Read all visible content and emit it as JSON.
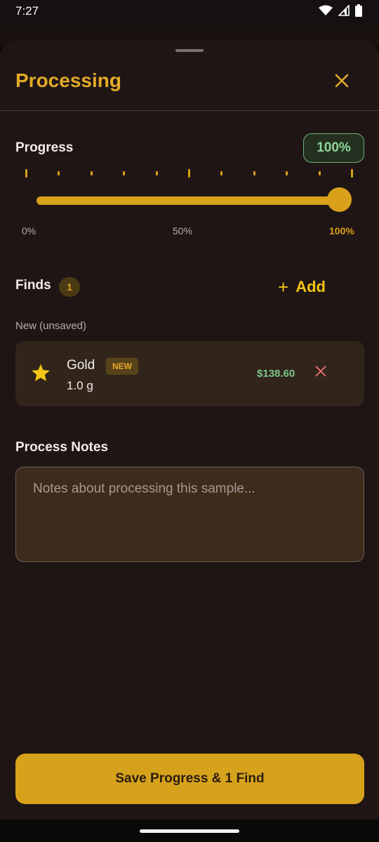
{
  "status_bar": {
    "time": "7:27",
    "icons": [
      "wifi-icon",
      "signal-icon",
      "battery-icon"
    ]
  },
  "sheet": {
    "title": "Processing",
    "close_icon": "close-icon"
  },
  "progress": {
    "label": "Progress",
    "value_label": "100%",
    "value_percent": 100,
    "scale": [
      "0%",
      "50%",
      "100%"
    ],
    "tick_count": 11
  },
  "finds": {
    "label": "Finds",
    "count": "1",
    "add_label": "Add",
    "group_label": "New (unsaved)",
    "items": [
      {
        "icon": "star-icon",
        "name": "Gold",
        "badge": "NEW",
        "quantity": "1.0 g",
        "value": "$138.60"
      }
    ]
  },
  "notes": {
    "label": "Process Notes",
    "placeholder": "Notes about processing this sample...",
    "value": ""
  },
  "save_button": {
    "label": "Save Progress & 1 Find"
  },
  "colors": {
    "accent": "#d9a019",
    "title": "#e2aa28",
    "sheet_bg": "#1f1514",
    "success": "#7cc48a",
    "danger": "#e06a6a"
  }
}
